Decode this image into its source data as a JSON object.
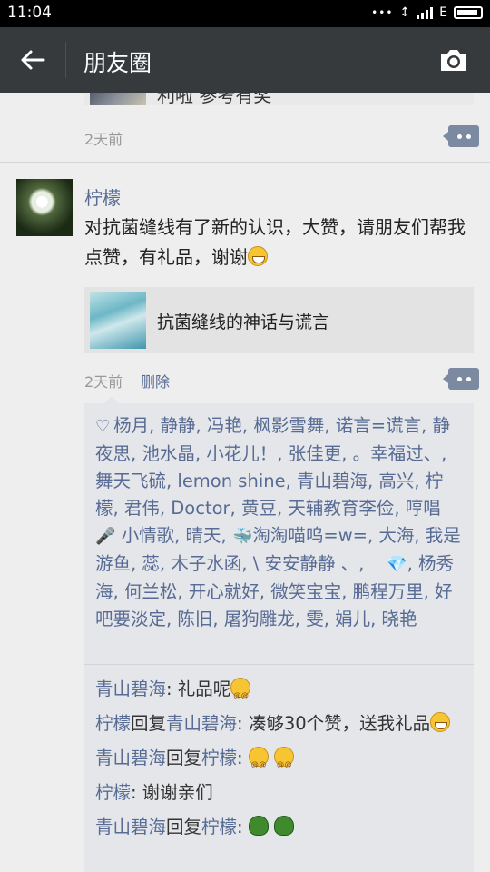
{
  "status_bar": {
    "time": "11:04",
    "network": "E"
  },
  "nav": {
    "title": "朋友圈"
  },
  "prev_post": {
    "link_title": "利啦 参考有奖",
    "time": "2天前"
  },
  "post": {
    "author": "柠檬",
    "text": "对抗菌缝线有了新的认识，大赞，请朋友们帮我点赞，有礼品，谢谢",
    "link_title": "抗菌缝线的神话与谎言",
    "time": "2天前",
    "delete_label": "删除",
    "likes_part1": "杨月, 静静, 冯艳, 枫影雪舞, 诺言=谎言, 静夜思, 池水晶, 小花儿！, 张佳更, 。幸福过、, 舞天飞硫, lemon shine, 青山碧海, 高兴, 柠檬, 君伟, Doctor, 黄豆, 天辅教育李俭, 哼唱",
    "likes_part2": "小情歌, 晴天,",
    "likes_part3": "淘淘喵呜=w=, 大海, 我是游鱼, 蕊, 木子水函, \\ 安安静静 、,",
    "likes_part4": ", 杨秀海, 何兰松, 开心就好, 微笑宝宝, 鹏程万里, 好吧要淡定, 陈旧, 屠狗雕龙, 雯, 娟儿, 晓艳",
    "comments": [
      {
        "name": "青山碧海",
        "text": ": 礼品呢"
      },
      {
        "name": "柠檬",
        "reply": "回复",
        "target": "青山碧海",
        "text": ": 凑够30个赞，送我礼品"
      },
      {
        "name": "青山碧海",
        "reply": "回复",
        "target": "柠檬",
        "text": ": "
      },
      {
        "name": "柠檬",
        "text": ": 谢谢亲们"
      },
      {
        "name": "青山碧海",
        "reply": "回复",
        "target": "柠檬",
        "text": ": "
      }
    ]
  },
  "icons": {
    "back": "arrow-left-icon",
    "camera": "camera-icon",
    "heart": "heart-icon",
    "comment": "comment-dots-icon"
  },
  "colors": {
    "nav_bg": "#373a3d",
    "name_link": "#576b95",
    "page_bg": "#eeeeee"
  }
}
